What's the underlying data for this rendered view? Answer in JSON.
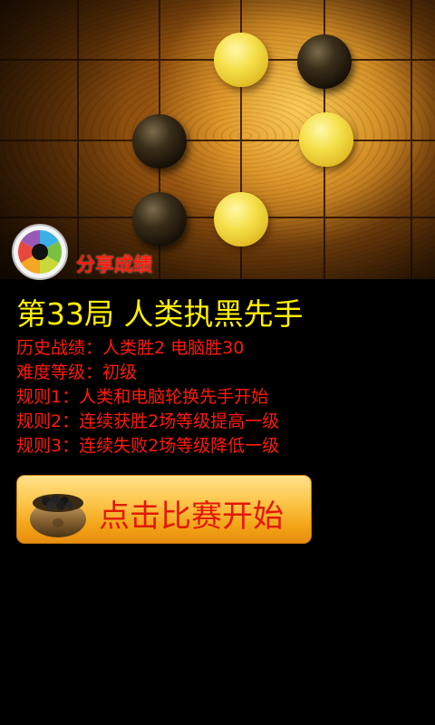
{
  "header": {
    "share_label": "分享成绩",
    "share_icon": "camera-aperture-icon"
  },
  "game": {
    "title": "第33局  人类执黑先手",
    "lines": [
      "历史战绩：人类胜2  电脑胜30",
      "难度等级：初级",
      "规则1：人类和电脑轮换先手开始",
      "规则2：连续获胜2场等级提高一级",
      "规则3：连续失败2场等级降低一级"
    ]
  },
  "start_button": {
    "label": "点击比赛开始",
    "icon": "go-stone-bowl-icon"
  },
  "colors": {
    "title": "#ffef00",
    "info_text": "#ff1a0a",
    "button_text": "#e21808",
    "background": "#000000"
  }
}
